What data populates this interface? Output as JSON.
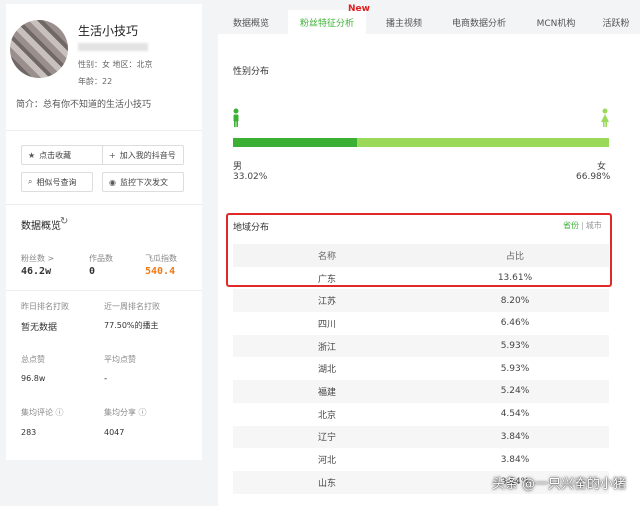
{
  "profile": {
    "name": "生活小技巧",
    "gender_line": "性别：女   地区：北京",
    "age_line": "年龄：22",
    "intro": "简介：总有你不知道的生活小技巧"
  },
  "actions": {
    "favorite": "点击收藏",
    "add_douyin": "加入我的抖音号",
    "similar": "相似号查询",
    "monitor": "监控下次发文"
  },
  "overview": {
    "title": "数据概览",
    "fans_label": "粉丝数 >",
    "fans_value": "46.2w",
    "works_label": "作品数",
    "works_value": "0",
    "index_label": "飞瓜指数",
    "index_value": "540.4",
    "yesterday_rank_label": "昨日排名打败",
    "yesterday_rank_value": "暂无数据",
    "week_rank_label": "近一周排名打败",
    "week_rank_value": "77.50%的播主",
    "total_likes_label": "总点赞",
    "total_likes_value": "96.8w",
    "avg_likes_label": "平均点赞",
    "avg_likes_value": "-",
    "avg_comments_label": "集均评论",
    "avg_comments_value": "283",
    "avg_shares_label": "集均分享",
    "avg_shares_value": "4047"
  },
  "tabs": [
    {
      "label": "数据概览"
    },
    {
      "label": "粉丝特征分析"
    },
    {
      "label": "播主视频"
    },
    {
      "label": "电商数据分析"
    },
    {
      "label": "MCN机构"
    },
    {
      "label": "活跃粉"
    }
  ],
  "new_badge": "New",
  "gender": {
    "title": "性别分布",
    "male_label": "男",
    "male_pct": "33.02%",
    "male_fraction": 0.3302,
    "female_label": "女",
    "female_pct": "66.98%",
    "colors": {
      "male": "#3cb034",
      "female": "#9ad95a"
    }
  },
  "region": {
    "title": "地域分布",
    "toggle_province": "省份",
    "toggle_city": "城市",
    "col_name": "名称",
    "col_ratio": "占比",
    "rows": [
      {
        "name": "广东",
        "ratio": "13.61%"
      },
      {
        "name": "江苏",
        "ratio": "8.20%"
      },
      {
        "name": "四川",
        "ratio": "6.46%"
      },
      {
        "name": "浙江",
        "ratio": "5.93%"
      },
      {
        "name": "湖北",
        "ratio": "5.93%"
      },
      {
        "name": "福建",
        "ratio": "5.24%"
      },
      {
        "name": "北京",
        "ratio": "4.54%"
      },
      {
        "name": "辽宁",
        "ratio": "3.84%"
      },
      {
        "name": "河北",
        "ratio": "3.84%"
      },
      {
        "name": "山东",
        "ratio": "3.84%"
      }
    ]
  },
  "watermark": "头条 @一只兴奋的小猪"
}
